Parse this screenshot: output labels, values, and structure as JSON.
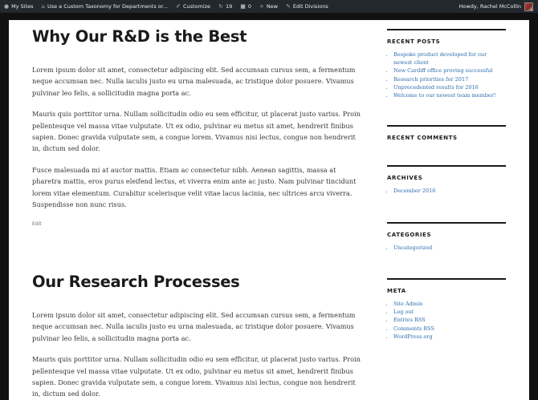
{
  "adminbar": {
    "my_sites": "My Sites",
    "site_name": "Use a Custom Taxonomy for Departments or...",
    "customize": "Customize",
    "updates_count": "19",
    "comments_count": "0",
    "new": "New",
    "edit_divisions": "Edit Divisions",
    "howdy": "Howdy, Rachel McCollin"
  },
  "posts": [
    {
      "title": "Why Our R&D is the Best",
      "paragraphs": [
        "Lorem ipsum dolor sit amet, consectetur adipiscing elit. Sed accumsan cursus sem, a fermentum neque accumsan nec. Nulla iaculis justo eu urna malesuada, ac tristique dolor posuere. Vivamus pulvinar leo felis, a sollicitudin magna porta ac.",
        "Mauris quis porttitor urna. Nullam sollicitudin odio eu sem efficitur, ut placerat justo varius. Proin pellentesque vel massa vitae vulputate. Ut ex odio, pulvinar eu metus sit amet, hendrerit finibus sapien. Donec gravida vulputate sem, a congue lorem. Vivamus nisi lectus, congue non hendrerit in, dictum sed dolor.",
        "Fusce malesuada mi at auctor mattis. Etiam ac consectetur nibh. Aenean sagittis, massa at pharetra mattis, eros purus eleifend lectus, et viverra enim ante ac justo. Nam pulvinar tincidunt lorem vitae elementum. Curabitur scelerisque velit vitae lacus lacinia, nec ultrices arcu viverra. Suspendisse non nunc risus."
      ],
      "edit_label": "Edit"
    },
    {
      "title": "Our Research Processes",
      "paragraphs": [
        "Lorem ipsum dolor sit amet, consectetur adipiscing elit. Sed accumsan cursus sem, a fermentum neque accumsan nec. Nulla iaculis justo eu urna malesuada, ac tristique dolor posuere. Vivamus pulvinar leo felis, a sollicitudin magna porta ac.",
        "Mauris quis porttitor urna. Nullam sollicitudin odio eu sem efficitur, ut placerat justo varius. Proin pellentesque vel massa vitae vulputate. Ut ex odio, pulvinar eu metus sit amet, hendrerit finibus sapien. Donec gravida vulputate sem, a congue lorem. Vivamus nisi lectus, congue non hendrerit in, dictum sed dolor."
      ]
    }
  ],
  "sidebar": {
    "recent_posts": {
      "title": "RECENT POSTS",
      "items": [
        "Bespoke product developed for our newest client",
        "New Cardiff office proving successful",
        "Research priorities for 2017",
        "Unprecedented results for 2016",
        "Welcome to our newest team member!"
      ]
    },
    "recent_comments": {
      "title": "RECENT COMMENTS"
    },
    "archives": {
      "title": "ARCHIVES",
      "items": [
        "December 2016"
      ]
    },
    "categories": {
      "title": "CATEGORIES",
      "items": [
        "Uncategorized"
      ]
    },
    "meta": {
      "title": "META",
      "items": [
        "Site Admin",
        "Log out",
        "Entries RSS",
        "Comments RSS",
        "WordPress.org"
      ]
    }
  },
  "colors": {
    "adminbar_bg": "#23282d",
    "page_bg": "#ffffff",
    "outer_bg": "#111111",
    "link": "#2b6cb0"
  },
  "icons": [
    "wordpress-icon",
    "home-icon",
    "brush-icon",
    "updates-icon",
    "comment-icon",
    "plus-icon",
    "pencil-icon"
  ]
}
